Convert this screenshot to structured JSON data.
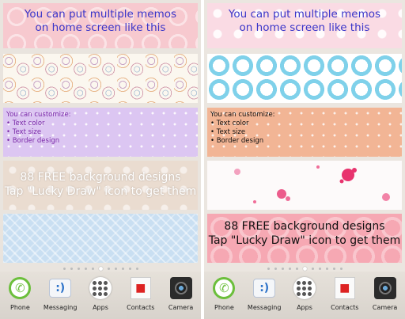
{
  "left": {
    "memo1": {
      "line1": "You can put multiple memos",
      "line2": "on home screen like this"
    },
    "memo3": {
      "line1": "You can customize:",
      "line2": "• Text color",
      "line3": "• Text size",
      "line4": "• Border design"
    },
    "memo4": {
      "line1": "88 FREE background designs",
      "line2": "Tap \"Lucky Draw\" icon to get them"
    }
  },
  "right": {
    "memo1": {
      "line1": "You can put multiple memos",
      "line2": "on home screen like this"
    },
    "memo3": {
      "line1": "You can customize:",
      "line2": "• Text color",
      "line3": "• Text size",
      "line4": "• Border design"
    },
    "memo5": {
      "line1": "88 FREE background designs",
      "line2": "Tap \"Lucky Draw\" icon to get them"
    }
  },
  "dock": {
    "phone": "Phone",
    "messaging": "Messaging",
    "apps": "Apps",
    "contacts": "Contacts",
    "camera": "Camera"
  },
  "icons": {
    "phone": "phone-icon",
    "messaging": "messaging-icon",
    "apps": "apps-grid-icon",
    "contacts": "contacts-icon",
    "camera": "camera-icon"
  },
  "colors": {
    "memo_text_blue": "#3a35c9",
    "memo_text_purple": "#7b2aa8"
  }
}
